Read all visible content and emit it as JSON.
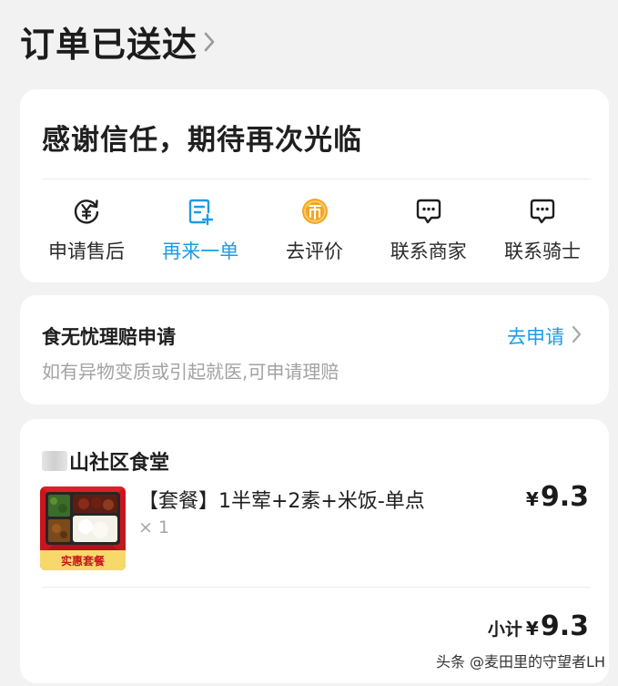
{
  "header": {
    "title": "订单已送达"
  },
  "thanks": {
    "title": "感谢信任，期待再次光临",
    "actions": [
      {
        "label": "申请售后",
        "icon": "yuan-refresh-icon"
      },
      {
        "label": "再来一单",
        "icon": "reorder-note-icon"
      },
      {
        "label": "去评价",
        "icon": "coin-icon"
      },
      {
        "label": "联系商家",
        "icon": "chat-bubble-icon"
      },
      {
        "label": "联系骑士",
        "icon": "chat-bubble-icon"
      }
    ]
  },
  "claim": {
    "title": "食无忧理赔申请",
    "subtitle": "如有异物变质或引起就医,可申请理赔",
    "link": "去申请"
  },
  "order": {
    "shop_name": "山社区食堂",
    "item": {
      "name": "【套餐】1半荤+2素+米饭-单点",
      "qty": "× 1",
      "currency": "¥",
      "price": "9.3",
      "image_label": "实惠套餐"
    },
    "subtotal": {
      "label": "小计",
      "currency": "¥",
      "value": "9.3"
    }
  },
  "watermark": "头条 @麦田里的守望者LH",
  "colors": {
    "accent": "#1e9be6",
    "coin": "#f5a623",
    "background": "#f2f2f2"
  }
}
